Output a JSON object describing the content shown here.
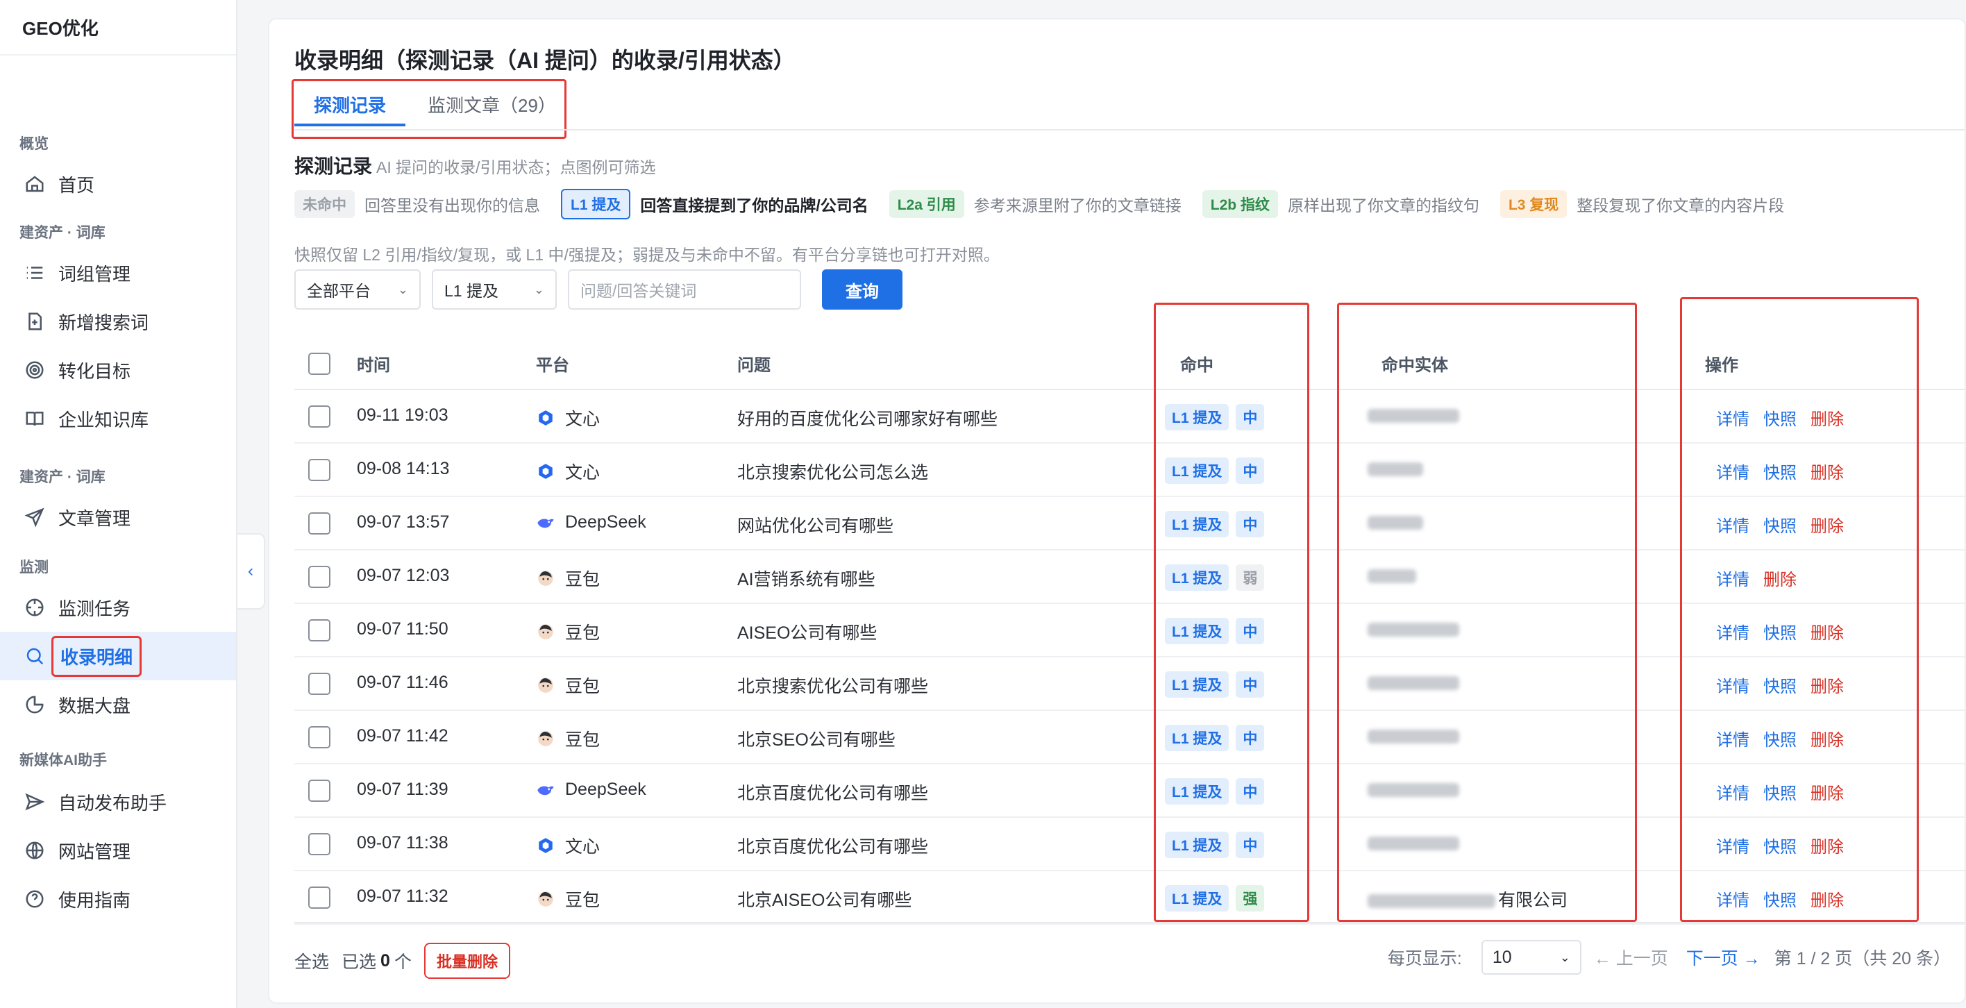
{
  "sidebar": {
    "brand": "GEO优化",
    "groups": [
      {
        "title": "概览",
        "items": [
          {
            "label": "首页",
            "icon": "home-icon"
          }
        ]
      },
      {
        "title": "建资产 · 词库",
        "items": [
          {
            "label": "词组管理",
            "icon": "list-icon"
          },
          {
            "label": "新增搜索词",
            "icon": "file-plus-icon"
          },
          {
            "label": "转化目标",
            "icon": "target-icon"
          },
          {
            "label": "企业知识库",
            "icon": "book-icon"
          }
        ]
      },
      {
        "title": "建资产 · 词库",
        "items": [
          {
            "label": "文章管理",
            "icon": "send-icon"
          }
        ]
      },
      {
        "title": "监测",
        "items": [
          {
            "label": "监测任务",
            "icon": "crosshair-icon"
          },
          {
            "label": "收录明细",
            "icon": "search-icon"
          },
          {
            "label": "数据大盘",
            "icon": "pie-chart-icon"
          }
        ]
      },
      {
        "title": "新媒体AI助手",
        "items": [
          {
            "label": "自动发布助手",
            "icon": "paper-plane-icon"
          },
          {
            "label": "网站管理",
            "icon": "globe-icon"
          },
          {
            "label": "使用指南",
            "icon": "help-circle-icon"
          }
        ]
      }
    ],
    "collapse_glyph": "‹"
  },
  "main": {
    "title": "收录明细（探测记录（AI 提问）的收录/引用状态）",
    "tabs": [
      {
        "label": "探测记录"
      },
      {
        "label": "监测文章（29）"
      }
    ],
    "section_title": "探测记录",
    "section_desc": "AI 提问的收录/引用状态；点图例可筛选",
    "legend": [
      {
        "tag": "未命中",
        "desc": "回答里没有出现你的信息"
      },
      {
        "tag": "L1 提及",
        "desc": "回答直接提到了你的品牌/公司名"
      },
      {
        "tag": "L2a 引用",
        "desc": "参考来源里附了你的文章链接"
      },
      {
        "tag": "L2b 指纹",
        "desc": "原样出现了你文章的指纹句"
      },
      {
        "tag": "L3 复现",
        "desc": "整段复现了你文章的内容片段"
      }
    ],
    "note": "快照仅留 L2 引用/指纹/复现，或 L1 中/强提及；弱提及与未命中不留。有平台分享链也可打开对照。",
    "filters": {
      "platform": "全部平台",
      "level": "L1 提及",
      "keyword_placeholder": "问题/回答关键词",
      "query_label": "查询"
    },
    "columns": {
      "time": "时间",
      "platform": "平台",
      "question": "问题",
      "hit": "命中",
      "entity": "命中实体",
      "actions": "操作"
    },
    "rows": [
      {
        "time": "09-11 19:03",
        "platform": "文心",
        "question": "好用的百度优化公司哪家好有哪些",
        "hit": "L1 提及",
        "level": "中",
        "entity_suffix": "",
        "actions": [
          "详情",
          "快照",
          "删除"
        ]
      },
      {
        "time": "09-08 14:13",
        "platform": "文心",
        "question": "北京搜索优化公司怎么选",
        "hit": "L1 提及",
        "level": "中",
        "entity_suffix": "",
        "actions": [
          "详情",
          "快照",
          "删除"
        ]
      },
      {
        "time": "09-07 13:57",
        "platform": "DeepSeek",
        "question": "网站优化公司有哪些",
        "hit": "L1 提及",
        "level": "中",
        "entity_suffix": "",
        "actions": [
          "详情",
          "快照",
          "删除"
        ]
      },
      {
        "time": "09-07 12:03",
        "platform": "豆包",
        "question": "AI营销系统有哪些",
        "hit": "L1 提及",
        "level": "弱",
        "entity_suffix": "",
        "actions": [
          "详情",
          "删除"
        ]
      },
      {
        "time": "09-07 11:50",
        "platform": "豆包",
        "question": "AISEO公司有哪些",
        "hit": "L1 提及",
        "level": "中",
        "entity_suffix": "",
        "actions": [
          "详情",
          "快照",
          "删除"
        ]
      },
      {
        "time": "09-07 11:46",
        "platform": "豆包",
        "question": "北京搜索优化公司有哪些",
        "hit": "L1 提及",
        "level": "中",
        "entity_suffix": "",
        "actions": [
          "详情",
          "快照",
          "删除"
        ]
      },
      {
        "time": "09-07 11:42",
        "platform": "豆包",
        "question": "北京SEO公司有哪些",
        "hit": "L1 提及",
        "level": "中",
        "entity_suffix": "",
        "actions": [
          "详情",
          "快照",
          "删除"
        ]
      },
      {
        "time": "09-07 11:39",
        "platform": "DeepSeek",
        "question": "北京百度优化公司有哪些",
        "hit": "L1 提及",
        "level": "中",
        "entity_suffix": "",
        "actions": [
          "详情",
          "快照",
          "删除"
        ]
      },
      {
        "time": "09-07 11:38",
        "platform": "文心",
        "question": "北京百度优化公司有哪些",
        "hit": "L1 提及",
        "level": "中",
        "entity_suffix": "",
        "actions": [
          "详情",
          "快照",
          "删除"
        ]
      },
      {
        "time": "09-07 11:32",
        "platform": "豆包",
        "question": "北京AISEO公司有哪些",
        "hit": "L1 提及",
        "level": "强",
        "entity_suffix": "有限公司",
        "actions": [
          "详情",
          "快照",
          "删除"
        ]
      }
    ],
    "footer": {
      "select_all": "全选",
      "selected_prefix": "已选",
      "selected_count": "0",
      "selected_suffix": "个",
      "bulk_delete": "批量删除",
      "page_size_label": "每页显示:",
      "page_size": "10",
      "prev": "← 上一页",
      "next": "下一页 →",
      "page_info": "第 1 / 2 页（共 20 条）"
    }
  },
  "colors": {
    "accent": "#1f6fe5",
    "danger": "#d93025",
    "highlight_box": "#e53935"
  }
}
